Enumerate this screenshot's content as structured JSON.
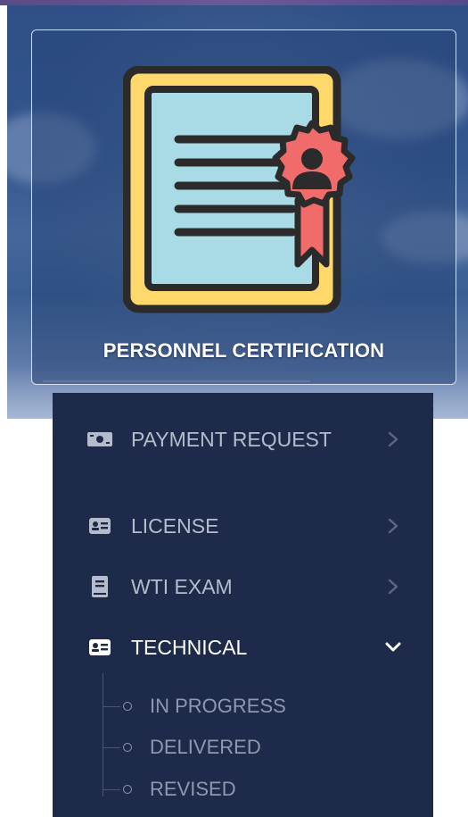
{
  "hero": {
    "card_title": "PERSONNEL CERTIFICATION",
    "icon": "certificate-icon"
  },
  "menu": {
    "items": [
      {
        "label": "PAYMENT REQUEST",
        "icon": "money-bill-icon",
        "chevron": "chevron-right-icon",
        "expanded": false
      },
      {
        "label": "LICENSE",
        "icon": "id-card-icon",
        "chevron": "chevron-right-icon",
        "expanded": false
      },
      {
        "label": "WTI EXAM",
        "icon": "book-icon",
        "chevron": "chevron-right-icon",
        "expanded": false
      },
      {
        "label": "TECHNICAL",
        "icon": "id-card-icon",
        "chevron": "chevron-down-icon",
        "expanded": true
      }
    ],
    "subitems": [
      {
        "label": "IN PROGRESS"
      },
      {
        "label": "DELIVERED"
      },
      {
        "label": "REVISED"
      }
    ]
  },
  "colors": {
    "menu_bg": "#1e2a49",
    "menu_text": "#b4bccc",
    "active_text": "#ffffff",
    "sub_text": "#8f98ad",
    "cert_paper": "#a9dbe6",
    "cert_frame": "#ffd86b",
    "cert_seal": "#f26b6b",
    "cert_outline": "#2b2b2b"
  }
}
